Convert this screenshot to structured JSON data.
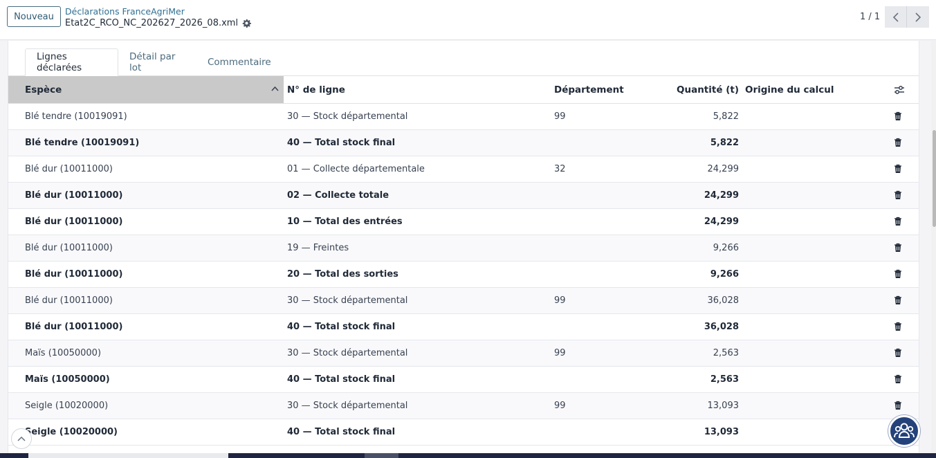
{
  "control_panel": {
    "new_button": "Nouveau",
    "breadcrumb_parent": "Déclarations FranceAgriMer",
    "breadcrumb_current": "Etat2C_RCO_NC_202627_2026_08.xml",
    "pager_value": "1 / 1"
  },
  "tabs": [
    {
      "label": "Lignes déclarées",
      "active": true
    },
    {
      "label": "Détail par lot",
      "active": false
    },
    {
      "label": "Commentaire",
      "active": false
    }
  ],
  "columns": {
    "espece": "Espèce",
    "ligne": "N° de ligne",
    "departement": "Département",
    "quantite": "Quantité (t)",
    "origine": "Origine du calcul"
  },
  "sort": {
    "column": "espece",
    "direction": "ascending"
  },
  "rows": [
    {
      "espece": "Blé tendre (10019091)",
      "ligne": "30 — Stock départemental",
      "departement": "99",
      "quantite": "5,822",
      "total": false
    },
    {
      "espece": "Blé tendre (10019091)",
      "ligne": "40 — Total stock final",
      "departement": "",
      "quantite": "5,822",
      "total": true
    },
    {
      "espece": "Blé dur (10011000)",
      "ligne": "01 — Collecte départementale",
      "departement": "32",
      "quantite": "24,299",
      "total": false
    },
    {
      "espece": "Blé dur (10011000)",
      "ligne": "02 — Collecte totale",
      "departement": "",
      "quantite": "24,299",
      "total": true
    },
    {
      "espece": "Blé dur (10011000)",
      "ligne": "10 — Total des entrées",
      "departement": "",
      "quantite": "24,299",
      "total": true
    },
    {
      "espece": "Blé dur (10011000)",
      "ligne": "19 — Freintes",
      "departement": "",
      "quantite": "9,266",
      "total": false
    },
    {
      "espece": "Blé dur (10011000)",
      "ligne": "20 — Total des sorties",
      "departement": "",
      "quantite": "9,266",
      "total": true
    },
    {
      "espece": "Blé dur (10011000)",
      "ligne": "30 — Stock départemental",
      "departement": "99",
      "quantite": "36,028",
      "total": false
    },
    {
      "espece": "Blé dur (10011000)",
      "ligne": "40 — Total stock final",
      "departement": "",
      "quantite": "36,028",
      "total": true
    },
    {
      "espece": "Maïs (10050000)",
      "ligne": "30 — Stock départemental",
      "departement": "99",
      "quantite": "2,563",
      "total": false
    },
    {
      "espece": "Maïs (10050000)",
      "ligne": "40 — Total stock final",
      "departement": "",
      "quantite": "2,563",
      "total": true
    },
    {
      "espece": "Seigle (10020000)",
      "ligne": "30 — Stock départemental",
      "departement": "99",
      "quantite": "13,093",
      "total": false
    },
    {
      "espece": "Seigle (10020000)",
      "ligne": "40 — Total stock final",
      "departement": "",
      "quantite": "13,093",
      "total": true
    }
  ],
  "icons": {
    "settings": "gear-icon",
    "prev": "chevron-left-icon",
    "next": "chevron-right-icon",
    "sort": "chevron-up-icon",
    "optional_columns": "sliders-icon",
    "row_delete": "trash-icon",
    "scroll_top": "chevron-up-icon",
    "chat": "users-icon"
  },
  "colors": {
    "link": "#2f6f93",
    "sorted_header": "#c9c9c9",
    "chat_button": "#24427a"
  }
}
